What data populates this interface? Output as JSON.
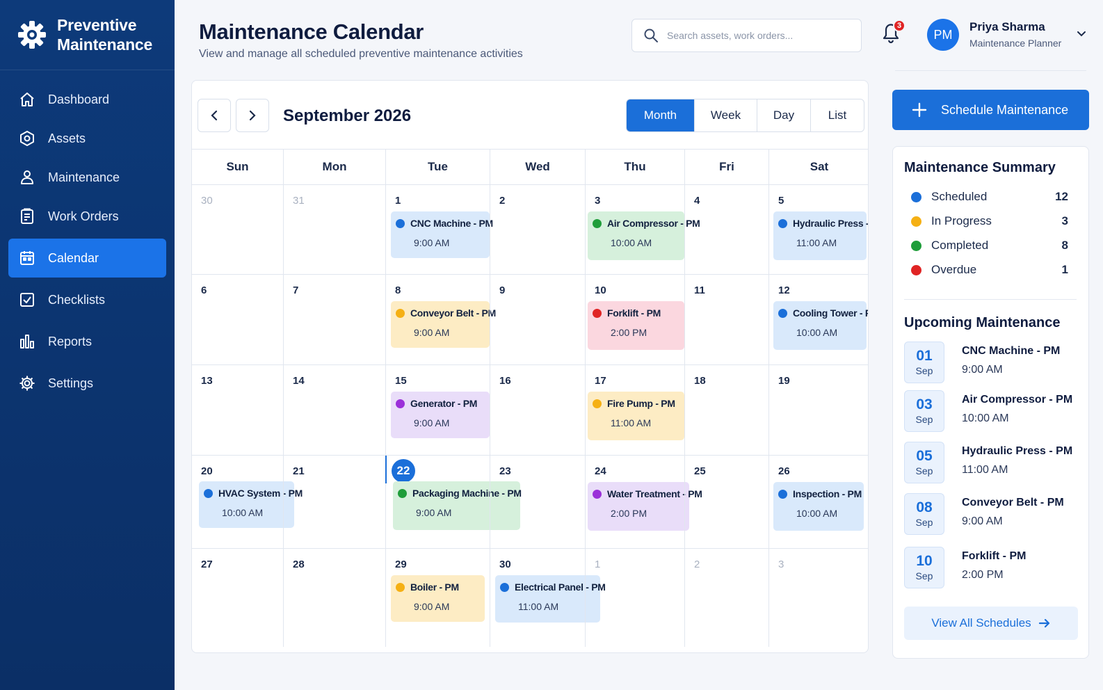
{
  "brand": {
    "line1": "Preventive",
    "line2": "Maintenance",
    "icon": "gear-icon"
  },
  "sidebar": {
    "items": [
      {
        "label": "Dashboard",
        "icon": "home-icon",
        "active": false
      },
      {
        "label": "Assets",
        "icon": "assets-icon",
        "active": false
      },
      {
        "label": "Maintenance",
        "icon": "technician-icon",
        "active": false
      },
      {
        "label": "Work Orders",
        "icon": "work-order-icon",
        "active": false
      },
      {
        "label": "Calendar",
        "icon": "calendar-icon",
        "active": true
      },
      {
        "label": "Checklists",
        "icon": "checklist-icon",
        "active": false
      },
      {
        "label": "Reports",
        "icon": "reports-icon",
        "active": false
      },
      {
        "label": "Settings",
        "icon": "gear-icon",
        "active": false
      }
    ]
  },
  "header": {
    "title": "Maintenance Calendar",
    "subtitle": "View and manage all scheduled preventive maintenance activities",
    "search_placeholder": "Search assets, work orders...",
    "notification_count": "3"
  },
  "user": {
    "initials": "PM",
    "name": "Priya Sharma",
    "role": "Maintenance Planner"
  },
  "calendar": {
    "month_label": "September 2026",
    "views": [
      "Month",
      "Week",
      "Day",
      "List"
    ],
    "active_view": "Month",
    "weekdays": [
      "Sun",
      "Mon",
      "Tue",
      "Wed",
      "Thu",
      "Fri",
      "Sat"
    ],
    "today": "22",
    "weeks": [
      [
        {
          "day": "30",
          "muted": true
        },
        {
          "day": "31",
          "muted": true
        },
        {
          "day": "1"
        },
        {
          "day": "2"
        },
        {
          "day": "3"
        },
        {
          "day": "4"
        },
        {
          "day": "5"
        }
      ],
      [
        {
          "day": "6"
        },
        {
          "day": "7"
        },
        {
          "day": "8"
        },
        {
          "day": "9"
        },
        {
          "day": "10"
        },
        {
          "day": "11"
        },
        {
          "day": "12"
        }
      ],
      [
        {
          "day": "13"
        },
        {
          "day": "14"
        },
        {
          "day": "15"
        },
        {
          "day": "16"
        },
        {
          "day": "17"
        },
        {
          "day": "18"
        },
        {
          "day": "19"
        }
      ],
      [
        {
          "day": "20"
        },
        {
          "day": "21"
        },
        {
          "day": "22"
        },
        {
          "day": "23"
        },
        {
          "day": "24"
        },
        {
          "day": "25"
        },
        {
          "day": "26"
        }
      ],
      [
        {
          "day": "27"
        },
        {
          "day": "28"
        },
        {
          "day": "29"
        },
        {
          "day": "30"
        },
        {
          "day": "1",
          "muted": true
        },
        {
          "day": "2",
          "muted": true
        },
        {
          "day": "3",
          "muted": true
        }
      ]
    ],
    "events": [
      {
        "title": "CNC Machine - PM",
        "time": "9:00 AM",
        "status": "scheduled"
      },
      {
        "title": "Air Compressor - PM",
        "time": "10:00 AM",
        "status": "completed"
      },
      {
        "title": "Hydraulic Press - PM",
        "time": "11:00 AM",
        "status": "scheduled"
      },
      {
        "title": "Conveyor Belt - PM",
        "time": "9:00 AM",
        "status": "in_progress"
      },
      {
        "title": "Forklift - PM",
        "time": "2:00 PM",
        "status": "overdue"
      },
      {
        "title": "Cooling Tower - PM",
        "time": "10:00 AM",
        "status": "scheduled"
      },
      {
        "title": "Generator - PM",
        "time": "9:00 AM",
        "status": "purple"
      },
      {
        "title": "Fire Pump - PM",
        "time": "11:00 AM",
        "status": "in_progress"
      },
      {
        "title": "HVAC System - PM",
        "time": "10:00 AM",
        "status": "scheduled"
      },
      {
        "title": "Packaging Machine - PM",
        "time": "9:00 AM",
        "status": "completed"
      },
      {
        "title": "Water Treatment - PM",
        "time": "2:00 PM",
        "status": "purple"
      },
      {
        "title": "Inspection - PM",
        "time": "10:00 AM",
        "status": "scheduled"
      },
      {
        "title": "Boiler - PM",
        "time": "9:00 AM",
        "status": "in_progress"
      },
      {
        "title": "Electrical Panel - PM",
        "time": "11:00 AM",
        "status": "scheduled"
      }
    ]
  },
  "schedule_button": {
    "label": "Schedule Maintenance"
  },
  "summary": {
    "title": "Maintenance Summary",
    "items": [
      {
        "label": "Scheduled",
        "count": "12",
        "color": "#1b6fd9"
      },
      {
        "label": "In Progress",
        "count": "3",
        "color": "#f5b014"
      },
      {
        "label": "Completed",
        "count": "8",
        "color": "#1f9d3a"
      },
      {
        "label": "Overdue",
        "count": "1",
        "color": "#e02424"
      }
    ]
  },
  "upcoming": {
    "title": "Upcoming Maintenance",
    "items": [
      {
        "day": "01",
        "month": "Sep",
        "title": "CNC Machine - PM",
        "time": "9:00 AM"
      },
      {
        "day": "03",
        "month": "Sep",
        "title": "Air Compressor - PM",
        "time": "10:00 AM"
      },
      {
        "day": "05",
        "month": "Sep",
        "title": "Hydraulic Press - PM",
        "time": "11:00 AM"
      },
      {
        "day": "08",
        "month": "Sep",
        "title": "Conveyor Belt - PM",
        "time": "9:00 AM"
      },
      {
        "day": "10",
        "month": "Sep",
        "title": "Forklift - PM",
        "time": "2:00 PM"
      }
    ],
    "view_all_label": "View All Schedules"
  },
  "colors": {
    "accent": "#1b6fd9",
    "sidebar": "#0d3a7a",
    "scheduled_bg": "#d9e9fb",
    "completed_bg": "#d6f0dc",
    "in_progress_bg": "#fdecc4",
    "overdue_bg": "#fbd7df",
    "purple_bg": "#e9ddf9"
  }
}
